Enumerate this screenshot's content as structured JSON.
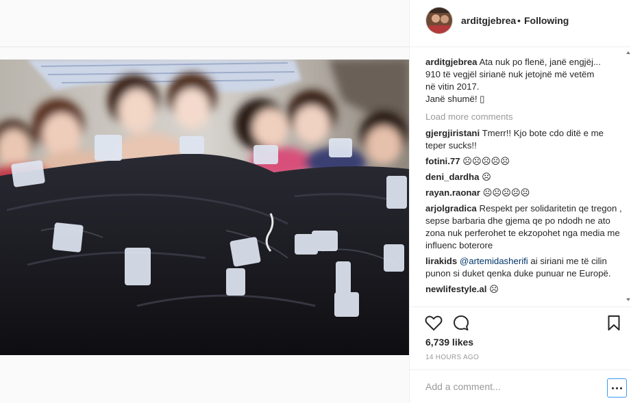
{
  "post": {
    "header_username": "arditgjebrea",
    "header_separator": "•",
    "follow_status": "Following",
    "caption": {
      "username": "arditgjebrea",
      "lines": [
        "Ata nuk po flenë, janë engjëj...",
        "910 të vegjël sirianë nuk jetojnë më vetëm",
        "në vitin 2017.",
        "Janë shumë! ▯"
      ]
    },
    "load_more_label": "Load more comments",
    "comments": [
      {
        "username": "gjergjiristani",
        "text": "Tmerr!! Kjo bote cdo ditë e me teper sucks!!"
      },
      {
        "username": "fotini.77",
        "text": "☹☹☹☹☹"
      },
      {
        "username": "deni_dardha",
        "text": "☹"
      },
      {
        "username": "rayan.raonar",
        "text": "☹☹☹☹☹"
      },
      {
        "username": "arjolgradica",
        "text": "Respekt per solidaritetin qe tregon , sepse barbaria dhe gjema qe po ndodh ne ato zona nuk perferohet te ekzopohet nga media me influenc boterore"
      },
      {
        "username": "lirakids",
        "mention": "@artemidasherifi",
        "text": " ai siriani me të cilin punon si duket qenka duke punuar ne Europë."
      },
      {
        "username": "newlifestyle.al",
        "text": "☹"
      }
    ],
    "likes": "6,739 likes",
    "time": "14 HOURS AGO",
    "add_comment_placeholder": "Add a comment..."
  },
  "icons": {
    "like": "heart-icon",
    "comment": "comment-bubble-icon",
    "save": "bookmark-icon",
    "more": "ellipsis-icon"
  },
  "colors": {
    "text": "#262626",
    "muted": "#999999",
    "mention": "#003569",
    "focus_border": "#3897f0",
    "border": "#efefef"
  }
}
